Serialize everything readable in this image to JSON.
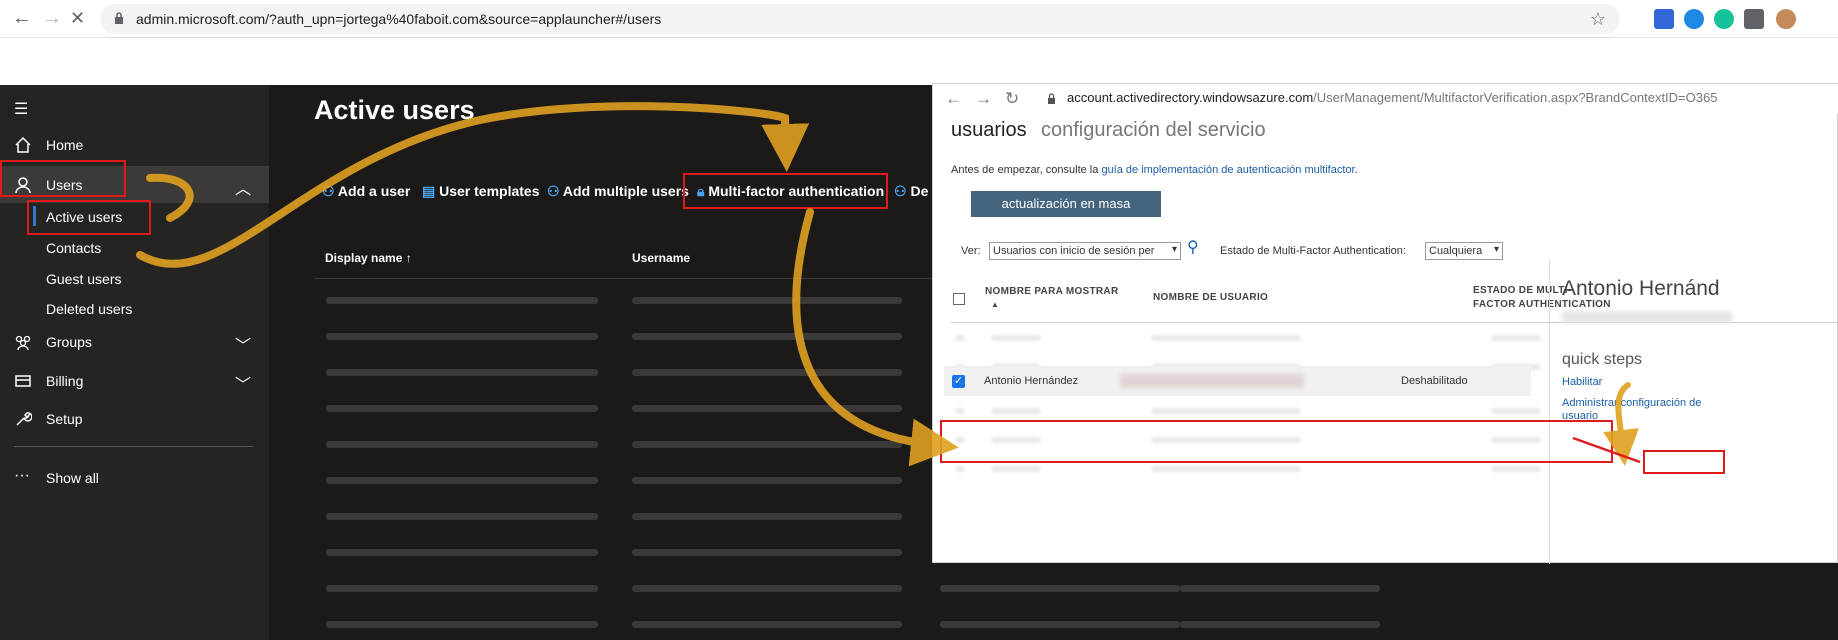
{
  "browser": {
    "url": "admin.microsoft.com/?auth_upn=jortega%40faboit.com&source=applauncher#/users"
  },
  "sidebar": {
    "items": [
      {
        "label": "Home"
      },
      {
        "label": "Users"
      },
      {
        "label": "Groups"
      },
      {
        "label": "Billing"
      },
      {
        "label": "Setup"
      },
      {
        "label": "Show all"
      }
    ],
    "users_sub": [
      {
        "label": "Active users"
      },
      {
        "label": "Contacts"
      },
      {
        "label": "Guest users"
      },
      {
        "label": "Deleted users"
      }
    ]
  },
  "main": {
    "title": "Active users",
    "commands": [
      {
        "label": "Add a user"
      },
      {
        "label": "User templates"
      },
      {
        "label": "Add multiple users"
      },
      {
        "label": "Multi-factor authentication"
      },
      {
        "label": "De"
      }
    ],
    "columns": [
      "Display name",
      "Username"
    ],
    "sort_arrow": "↑"
  },
  "popup": {
    "url_host": "account.activedirectory.windowsazure.com",
    "url_path": "/UserManagement/MultifactorVerification.aspx?BrandContextID=O365",
    "tabs": [
      "usuarios",
      "configuración del servicio"
    ],
    "intro_text": "Antes de empezar, consulte la ",
    "intro_link": "guía de implementación de autenticación multifactor",
    "intro_end": ".",
    "bulk_button": "actualización en masa",
    "view_label": "Ver:",
    "view_value": "Usuarios con inicio de sesión per",
    "status_label": "Estado de Multi-Factor Authentication:",
    "status_value": "Cualquiera",
    "columns": [
      "NOMBRE PARA MOSTRAR",
      "NOMBRE DE USUARIO",
      "ESTADO DE MULTI-",
      "FACTOR AUTHENTICATION"
    ],
    "selected_row": {
      "name": "Antonio Hernández",
      "status": "Deshabilitado"
    },
    "detail": {
      "name": "Antonio Hernánd",
      "quick_steps": "quick steps",
      "enable": "Habilitar",
      "manage1": "Administrar configuración de",
      "manage2": "usuario"
    }
  },
  "colors": {
    "highlight": "#e01b1b",
    "arrow": "#e0a020",
    "accent": "#0078d4"
  }
}
